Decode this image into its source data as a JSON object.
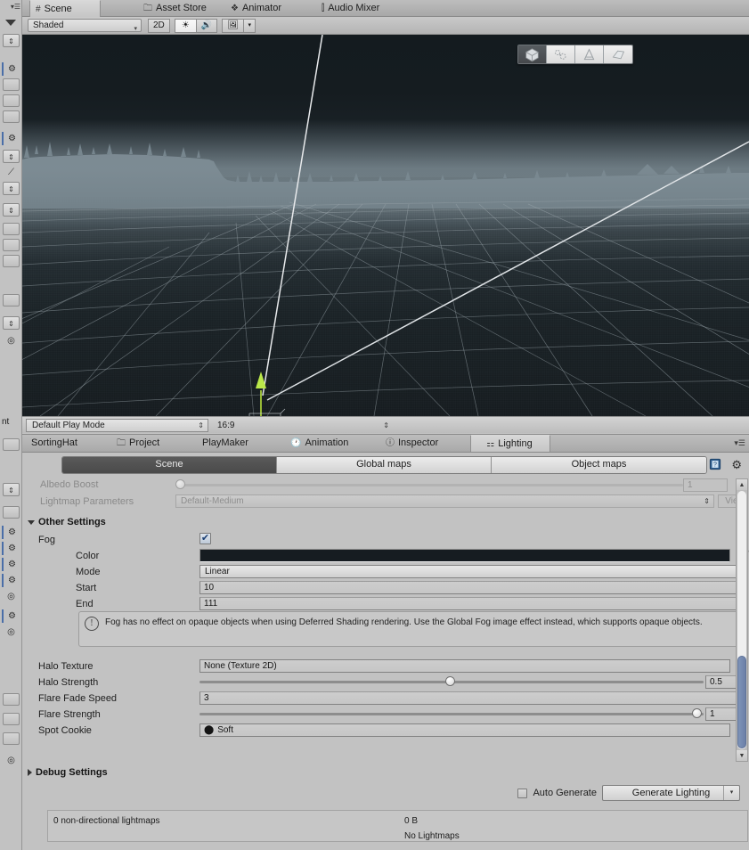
{
  "editor": {
    "scene_tabs": [
      {
        "label": "Scene",
        "icon": "grid-icon",
        "active": true
      },
      {
        "label": "Asset Store",
        "icon": "store-icon",
        "active": false
      },
      {
        "label": "Animator",
        "icon": "animator-icon",
        "active": false
      },
      {
        "label": "Audio Mixer",
        "icon": "mixer-icon",
        "active": false
      }
    ],
    "scene_toolbar": {
      "draw_mode": "Shaded",
      "view_2d": "2D",
      "lighting_toggle": "light-icon",
      "audio_toggle": "speaker-icon",
      "effects_toggle": "image-icon",
      "effects_caret": "▾"
    },
    "gizmo_buttons": [
      {
        "name": "render-mode-gizmo",
        "selected": true
      },
      {
        "name": "particles-gizmo",
        "selected": false
      },
      {
        "name": "light-cone-gizmo",
        "selected": false
      },
      {
        "name": "plane-gizmo",
        "selected": false
      }
    ],
    "playbar": {
      "play_mode": "Default Play Mode",
      "aspect": "16:9"
    }
  },
  "lighting": {
    "panel_tabs": [
      {
        "label": "SortingHat",
        "icon": "",
        "active": false
      },
      {
        "label": "Project",
        "icon": "folder-icon",
        "active": false
      },
      {
        "label": "PlayMaker",
        "icon": "",
        "active": false
      },
      {
        "label": "Animation",
        "icon": "clock-icon",
        "active": false
      },
      {
        "label": "Inspector",
        "icon": "info-icon",
        "active": false
      },
      {
        "label": "Lighting",
        "icon": "lighting-icon",
        "active": true
      }
    ],
    "segments": [
      {
        "label": "Scene",
        "active": true
      },
      {
        "label": "Global maps",
        "active": false
      },
      {
        "label": "Object maps",
        "active": false
      }
    ],
    "help_icon": "help-book-icon",
    "gear_icon": "gear-icon",
    "top_rows": [
      {
        "label": "Albedo Boost",
        "type": "slider",
        "value": "1",
        "disabled": true,
        "knob_pct": 0
      },
      {
        "label": "Lightmap Parameters",
        "type": "dropdown",
        "value": "Default-Medium",
        "disabled": true,
        "button": "View"
      }
    ],
    "other_settings": {
      "title": "Other Settings",
      "expanded": true,
      "fog": {
        "label": "Fog",
        "checked": true
      },
      "color": {
        "label": "Color",
        "value_hex": "#161c21",
        "picker_icon": "eyedropper-icon"
      },
      "mode": {
        "label": "Mode",
        "value": "Linear"
      },
      "start": {
        "label": "Start",
        "value": "10"
      },
      "end": {
        "label": "End",
        "value": "111"
      },
      "warning": "Fog has no effect on opaque objects when using Deferred Shading rendering. Use the Global Fog image effect instead, which supports opaque objects.",
      "halo_texture": {
        "label": "Halo Texture",
        "value": "None (Texture 2D)"
      },
      "halo_strength": {
        "label": "Halo Strength",
        "value": "0.5",
        "knob_pct": 49
      },
      "flare_fade_speed": {
        "label": "Flare Fade Speed",
        "value": "3"
      },
      "flare_strength": {
        "label": "Flare Strength",
        "value": "1",
        "knob_pct": 98
      },
      "spot_cookie": {
        "label": "Spot Cookie",
        "value": "Soft"
      }
    },
    "debug_settings": {
      "title": "Debug Settings",
      "expanded": false
    },
    "generate": {
      "auto_generate_label": "Auto Generate",
      "auto_generate_checked": false,
      "button_label": "Generate Lighting",
      "dropdown_caret": "▾"
    },
    "status": {
      "lightmaps_count": "0 non-directional lightmaps",
      "size": "0 B",
      "state": "No Lightmaps"
    }
  },
  "colors": {
    "panel_bg": "#c2c2c2",
    "accent_blue": "#6d81a8",
    "fog_color": "#161c21",
    "selection_dark": "#4a4a4a"
  }
}
